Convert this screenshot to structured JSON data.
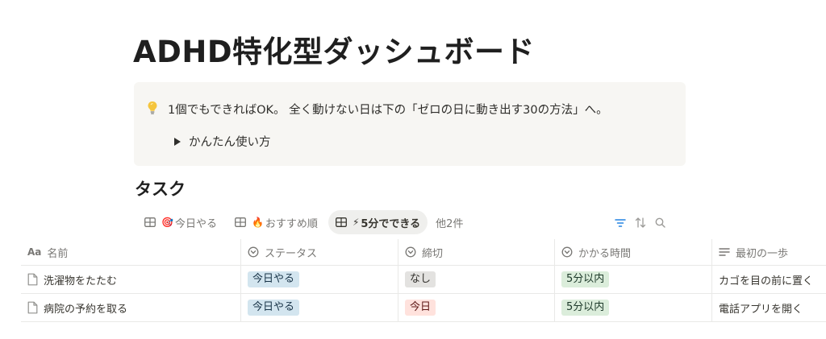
{
  "page": {
    "title": "ADHD特化型ダッシュボード"
  },
  "callout": {
    "icon": "lightbulb-icon",
    "text": "1個でもできればOK。 全く動けない日は下の「ゼロの日に動き出す30の方法」へ。",
    "toggle_label": "かんたん使い方"
  },
  "database": {
    "title": "タスク",
    "views": [
      {
        "emoji": "🎯",
        "label": "今日やる",
        "active": false
      },
      {
        "emoji": "🔥",
        "label": "おすすめ順",
        "active": false
      },
      {
        "emoji": "⚡",
        "label": "5分でできる",
        "active": true
      }
    ],
    "more_views": "他2件",
    "tools": [
      "filter-icon",
      "sort-icon",
      "search-icon"
    ],
    "columns": {
      "name": "名前",
      "status": "ステータス",
      "deadline": "締切",
      "duration": "かかる時間",
      "first_step": "最初の一歩"
    },
    "name_type_label": "Aa",
    "rows": [
      {
        "name": "洗濯物をたたむ",
        "status": "今日やる",
        "deadline": "なし",
        "duration": "5分以内",
        "first_step": "カゴを目の前に置く"
      },
      {
        "name": "病院の予約を取る",
        "status": "今日やる",
        "deadline": "今日",
        "duration": "5分以内",
        "first_step": "電話アプリを開く"
      }
    ]
  },
  "colors": {
    "status_tag": "#d3e5ef",
    "deadline_none_tag": "#e3e2e0",
    "deadline_today_tag": "#ffe2dd",
    "duration_tag": "#dbeddb",
    "filter_icon_accent": "#2383e2"
  }
}
